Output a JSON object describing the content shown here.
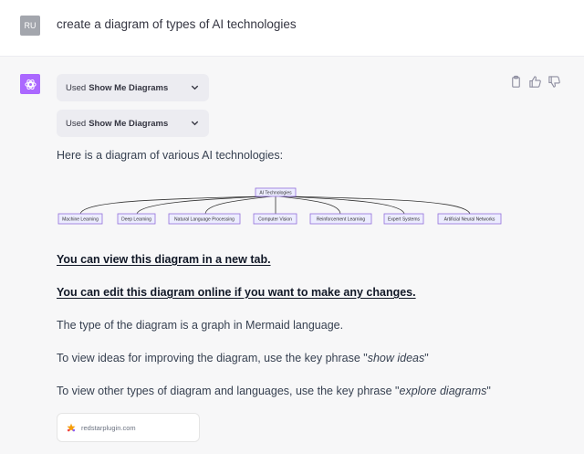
{
  "user": {
    "avatar_text": "RU",
    "message": "create a diagram of types of AI technologies"
  },
  "assistant": {
    "plugin_chips": [
      {
        "prefix": "Used",
        "name": "Show Me Diagrams"
      },
      {
        "prefix": "Used",
        "name": "Show Me Diagrams"
      }
    ],
    "intro": "Here is a diagram of various AI technologies:",
    "diagram": {
      "root": "AI Technologies",
      "children": [
        "Machine Learning",
        "Deep Learning",
        "Natural Language Processing",
        "Computer Vision",
        "Reinforcement Learning",
        "Expert Systems",
        "Artificial Neural Networks"
      ]
    },
    "link_view": "You can view this diagram in a new tab.",
    "link_edit": "You can edit this diagram online if you want to make any changes.",
    "type_text": "The type of the diagram is a graph in Mermaid language.",
    "ideas_prefix": "To view ideas for improving the diagram, use the key phrase \"",
    "ideas_phrase": "show ideas",
    "ideas_suffix": "\"",
    "explore_prefix": "To view other types of diagram and languages, use the key phrase \"",
    "explore_phrase": "explore diagrams",
    "explore_suffix": "\"",
    "source": "redstarplugin.com"
  },
  "colors": {
    "bot_avatar": "#ab68ff",
    "node_fill": "#ececff",
    "node_stroke": "#9370db"
  }
}
